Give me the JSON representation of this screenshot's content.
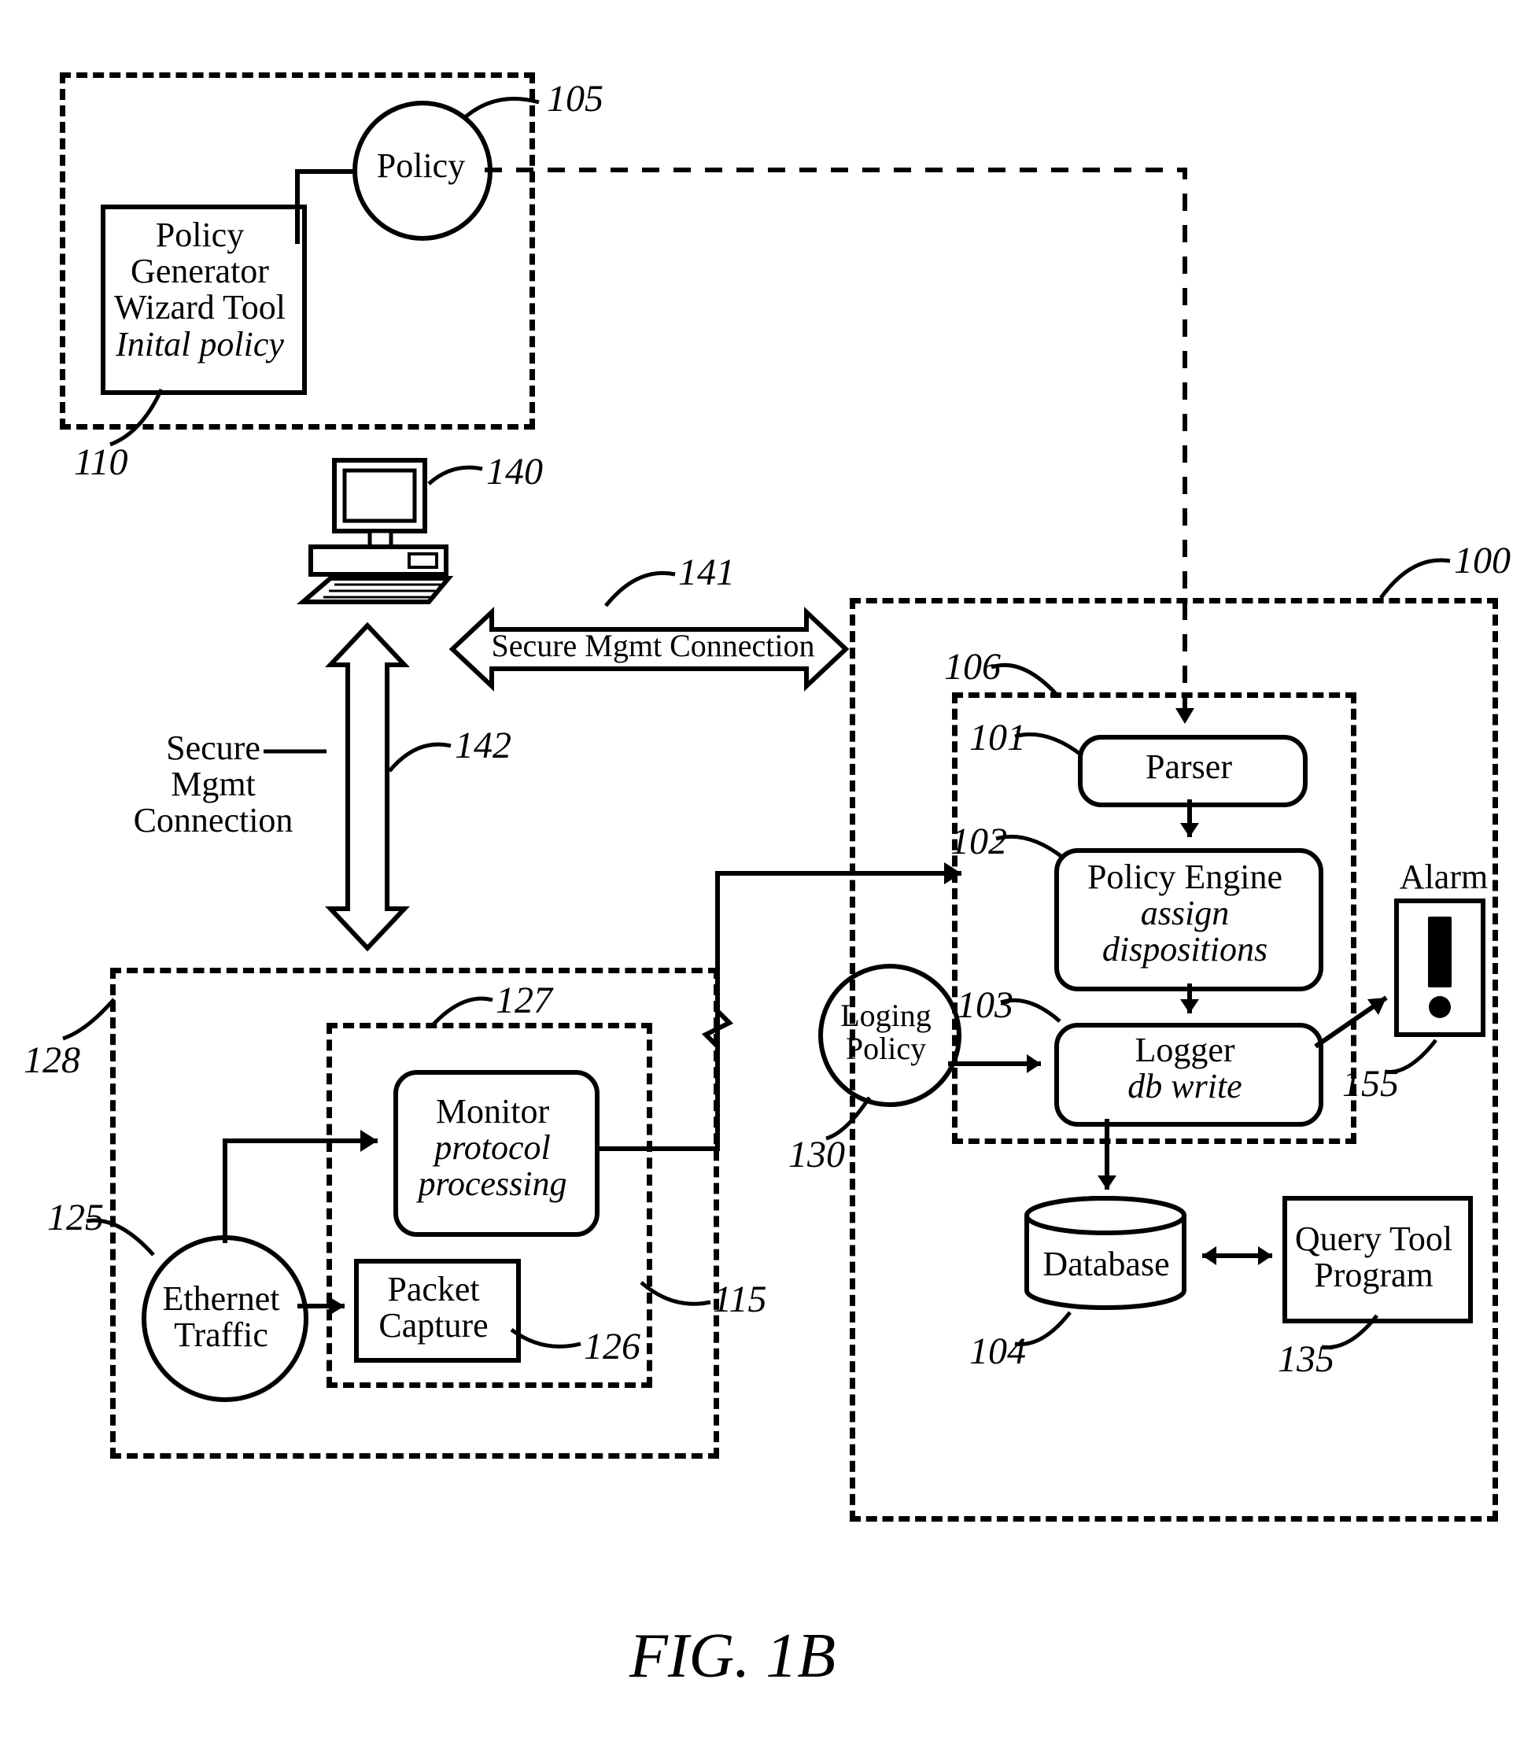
{
  "figure_label": "FIG. 1B",
  "refs": {
    "r100": "100",
    "r101": "101",
    "r102": "102",
    "r103": "103",
    "r104": "104",
    "r105": "105",
    "r106": "106",
    "r110": "110",
    "r115": "115",
    "r125": "125",
    "r126": "126",
    "r127": "127",
    "r128": "128",
    "r130": "130",
    "r135": "135",
    "r140": "140",
    "r141": "141",
    "r142": "142",
    "r155": "155"
  },
  "labels": {
    "policy": "Policy",
    "policy_gen_l1": "Policy",
    "policy_gen_l2": "Generator",
    "policy_gen_l3": "Wizard Tool",
    "policy_gen_l4": "Inital policy",
    "secure_mgmt_conn": "Secure Mgmt Connection",
    "secure_l1": "Secure",
    "secure_l2": "Mgmt",
    "secure_l3": "Connection",
    "monitor_l1": "Monitor",
    "monitor_l2": "protocol",
    "monitor_l3": "processing",
    "packet_l1": "Packet",
    "packet_l2": "Capture",
    "ethernet_l1": "Ethernet",
    "ethernet_l2": "Traffic",
    "parser": "Parser",
    "policy_engine_l1": "Policy Engine",
    "policy_engine_l2": "assign",
    "policy_engine_l3": "dispositions",
    "logger_l1": "Logger",
    "logger_l2": "db write",
    "loging_l1": "Loging",
    "loging_l2": "Policy",
    "database": "Database",
    "query_l1": "Query Tool",
    "query_l2": "Program",
    "alarm": "Alarm"
  }
}
